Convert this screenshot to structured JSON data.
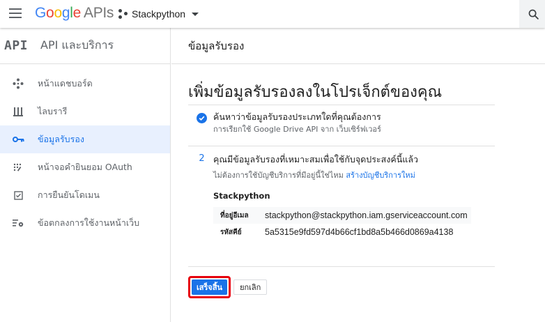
{
  "topbar": {
    "logo_g": "G",
    "logo_o1": "o",
    "logo_o2": "o",
    "logo_g2": "g",
    "logo_l": "l",
    "logo_e": "e",
    "logo_apis": "APIs",
    "project_name": "Stackpython"
  },
  "sidebar": {
    "api_mark": "API",
    "title": "API และบริการ",
    "items": [
      {
        "label": "หน้าแดชบอร์ด",
        "icon": "dashboard-icon",
        "active": false
      },
      {
        "label": "ไลบรารี",
        "icon": "library-icon",
        "active": false
      },
      {
        "label": "ข้อมูลรับรอง",
        "icon": "key-icon",
        "active": true
      },
      {
        "label": "หน้าจอคำยินยอม OAuth",
        "icon": "oauth-consent-icon",
        "active": false
      },
      {
        "label": "การยืนยันโดเมน",
        "icon": "domain-check-icon",
        "active": false
      },
      {
        "label": "ข้อตกลงการใช้งานหน้าเว็บ",
        "icon": "page-settings-icon",
        "active": false
      }
    ]
  },
  "main": {
    "header": "ข้อมูลรับรอง",
    "page_title": "เพิ่มข้อมูลรับรองลงในโปรเจ็กต์ของคุณ",
    "step1": {
      "title": "ค้นหาว่าข้อมูลรับรองประเภทใดที่คุณต้องการ",
      "subtitle": "การเรียกใช้ Google Drive API จาก เว็บเซิร์ฟเวอร์"
    },
    "step2": {
      "number": "2",
      "title": "คุณมีข้อมูลรับรองที่เหมาะสมเพื่อใช้กับจุดประสงค์นี้แล้ว",
      "subtitle": "ไม่ต้องการใช้บัญชีบริการที่มีอยู่นี้ใช่ไหม",
      "link": "สร้างบัญชีบริการใหม่",
      "account_name": "Stackpython",
      "rows": [
        {
          "key": "ที่อยู่อีเมล",
          "value": "stackpython@stackpython.iam.gserviceaccount.com"
        },
        {
          "key": "รหัสคีย์",
          "value": "5a5315e9fd597d4b66cf1bd8a5b466d0869a4138"
        }
      ]
    },
    "done_button": "เสร็จสิ้น",
    "cancel_button": "ยกเลิก"
  },
  "colors": {
    "accent": "#1a73e8",
    "highlight_border": "#e8000d",
    "active_nav_bg": "#e8f0fe"
  }
}
